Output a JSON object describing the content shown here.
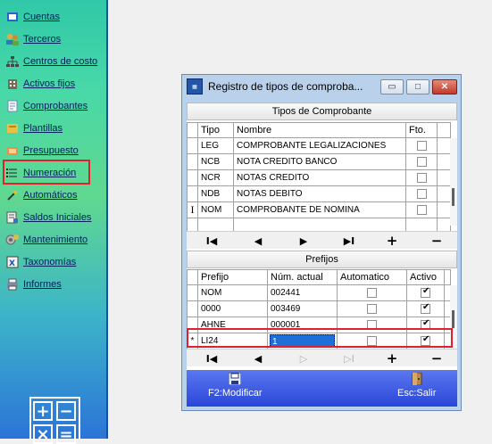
{
  "sidebar": {
    "items": [
      {
        "label": "Cuentas",
        "icon": "book-icon"
      },
      {
        "label": "Terceros",
        "icon": "users-icon"
      },
      {
        "label": "Centros de costo",
        "icon": "hierarchy-icon"
      },
      {
        "label": "Activos fijos",
        "icon": "building-icon"
      },
      {
        "label": "Comprobantes",
        "icon": "receipt-icon"
      },
      {
        "label": "Plantillas",
        "icon": "template-icon"
      },
      {
        "label": "Presupuesto",
        "icon": "budget-icon"
      },
      {
        "label": "Numeración",
        "icon": "list-numbers-icon"
      },
      {
        "label": "Automáticos",
        "icon": "magic-wand-icon"
      },
      {
        "label": "Saldos Iniciales",
        "icon": "ledger-icon"
      },
      {
        "label": "Mantenimiento",
        "icon": "gears-icon"
      },
      {
        "label": "Taxonomías",
        "icon": "taxonomy-icon"
      },
      {
        "label": "Informes",
        "icon": "printer-icon"
      }
    ],
    "calculator": {
      "icon": "calculator-icon",
      "plus": "+",
      "minus": "−",
      "times": "×",
      "equals": "="
    }
  },
  "window": {
    "title": "Registro de tipos de comproba...",
    "minimize": "▭",
    "maximize": "□",
    "close": "✕",
    "tipos_panel_title": "Tipos de Comprobante",
    "tipos_columns": [
      "Tipo",
      "Nombre",
      "Fto."
    ],
    "tipos_rows": [
      {
        "indicator": "",
        "tipo": "LEG",
        "nombre": "COMPROBANTE LEGALIZACIONES",
        "fto": false
      },
      {
        "indicator": "",
        "tipo": "NCB",
        "nombre": "NOTA CREDITO BANCO",
        "fto": false
      },
      {
        "indicator": "",
        "tipo": "NCR",
        "nombre": "NOTAS CREDITO",
        "fto": false
      },
      {
        "indicator": "",
        "tipo": "NDB",
        "nombre": "NOTAS DEBITO",
        "fto": false
      },
      {
        "indicator": "I",
        "tipo": "NOM",
        "nombre": "COMPROBANTE DE NOMINA",
        "fto": false
      }
    ],
    "prefijos_panel_title": "Prefijos",
    "prefijos_columns": [
      "Prefijo",
      "Núm. actual",
      "Automatico",
      "Activo"
    ],
    "prefijos_rows": [
      {
        "indicator": "",
        "prefijo": "NOM",
        "num": "002441",
        "auto": false,
        "activo": true
      },
      {
        "indicator": "",
        "prefijo": "0000",
        "num": "003469",
        "auto": false,
        "activo": true
      },
      {
        "indicator": "",
        "prefijo": "AHNE",
        "num": "000001",
        "auto": false,
        "activo": true
      },
      {
        "indicator": "*",
        "prefijo": "LI24",
        "num": "1",
        "auto": false,
        "activo": true
      }
    ],
    "nav": {
      "first": "I◀",
      "prev": "◀",
      "next": "▶",
      "last": "▶I",
      "add": "+",
      "delete": "−"
    },
    "nav2": {
      "first": "I◀",
      "prev": "◀",
      "next": "▷",
      "last": "▷I",
      "add": "+",
      "delete": "−"
    },
    "toolbar": {
      "modify_label": "F2:Modificar",
      "modify_icon": "save-icon",
      "exit_label": "Esc:Salir",
      "exit_icon": "door-exit-icon"
    }
  },
  "colors": {
    "highlight": "#e0202c",
    "selection": "#1e6fd8",
    "toolbar": "#3a58e0"
  }
}
